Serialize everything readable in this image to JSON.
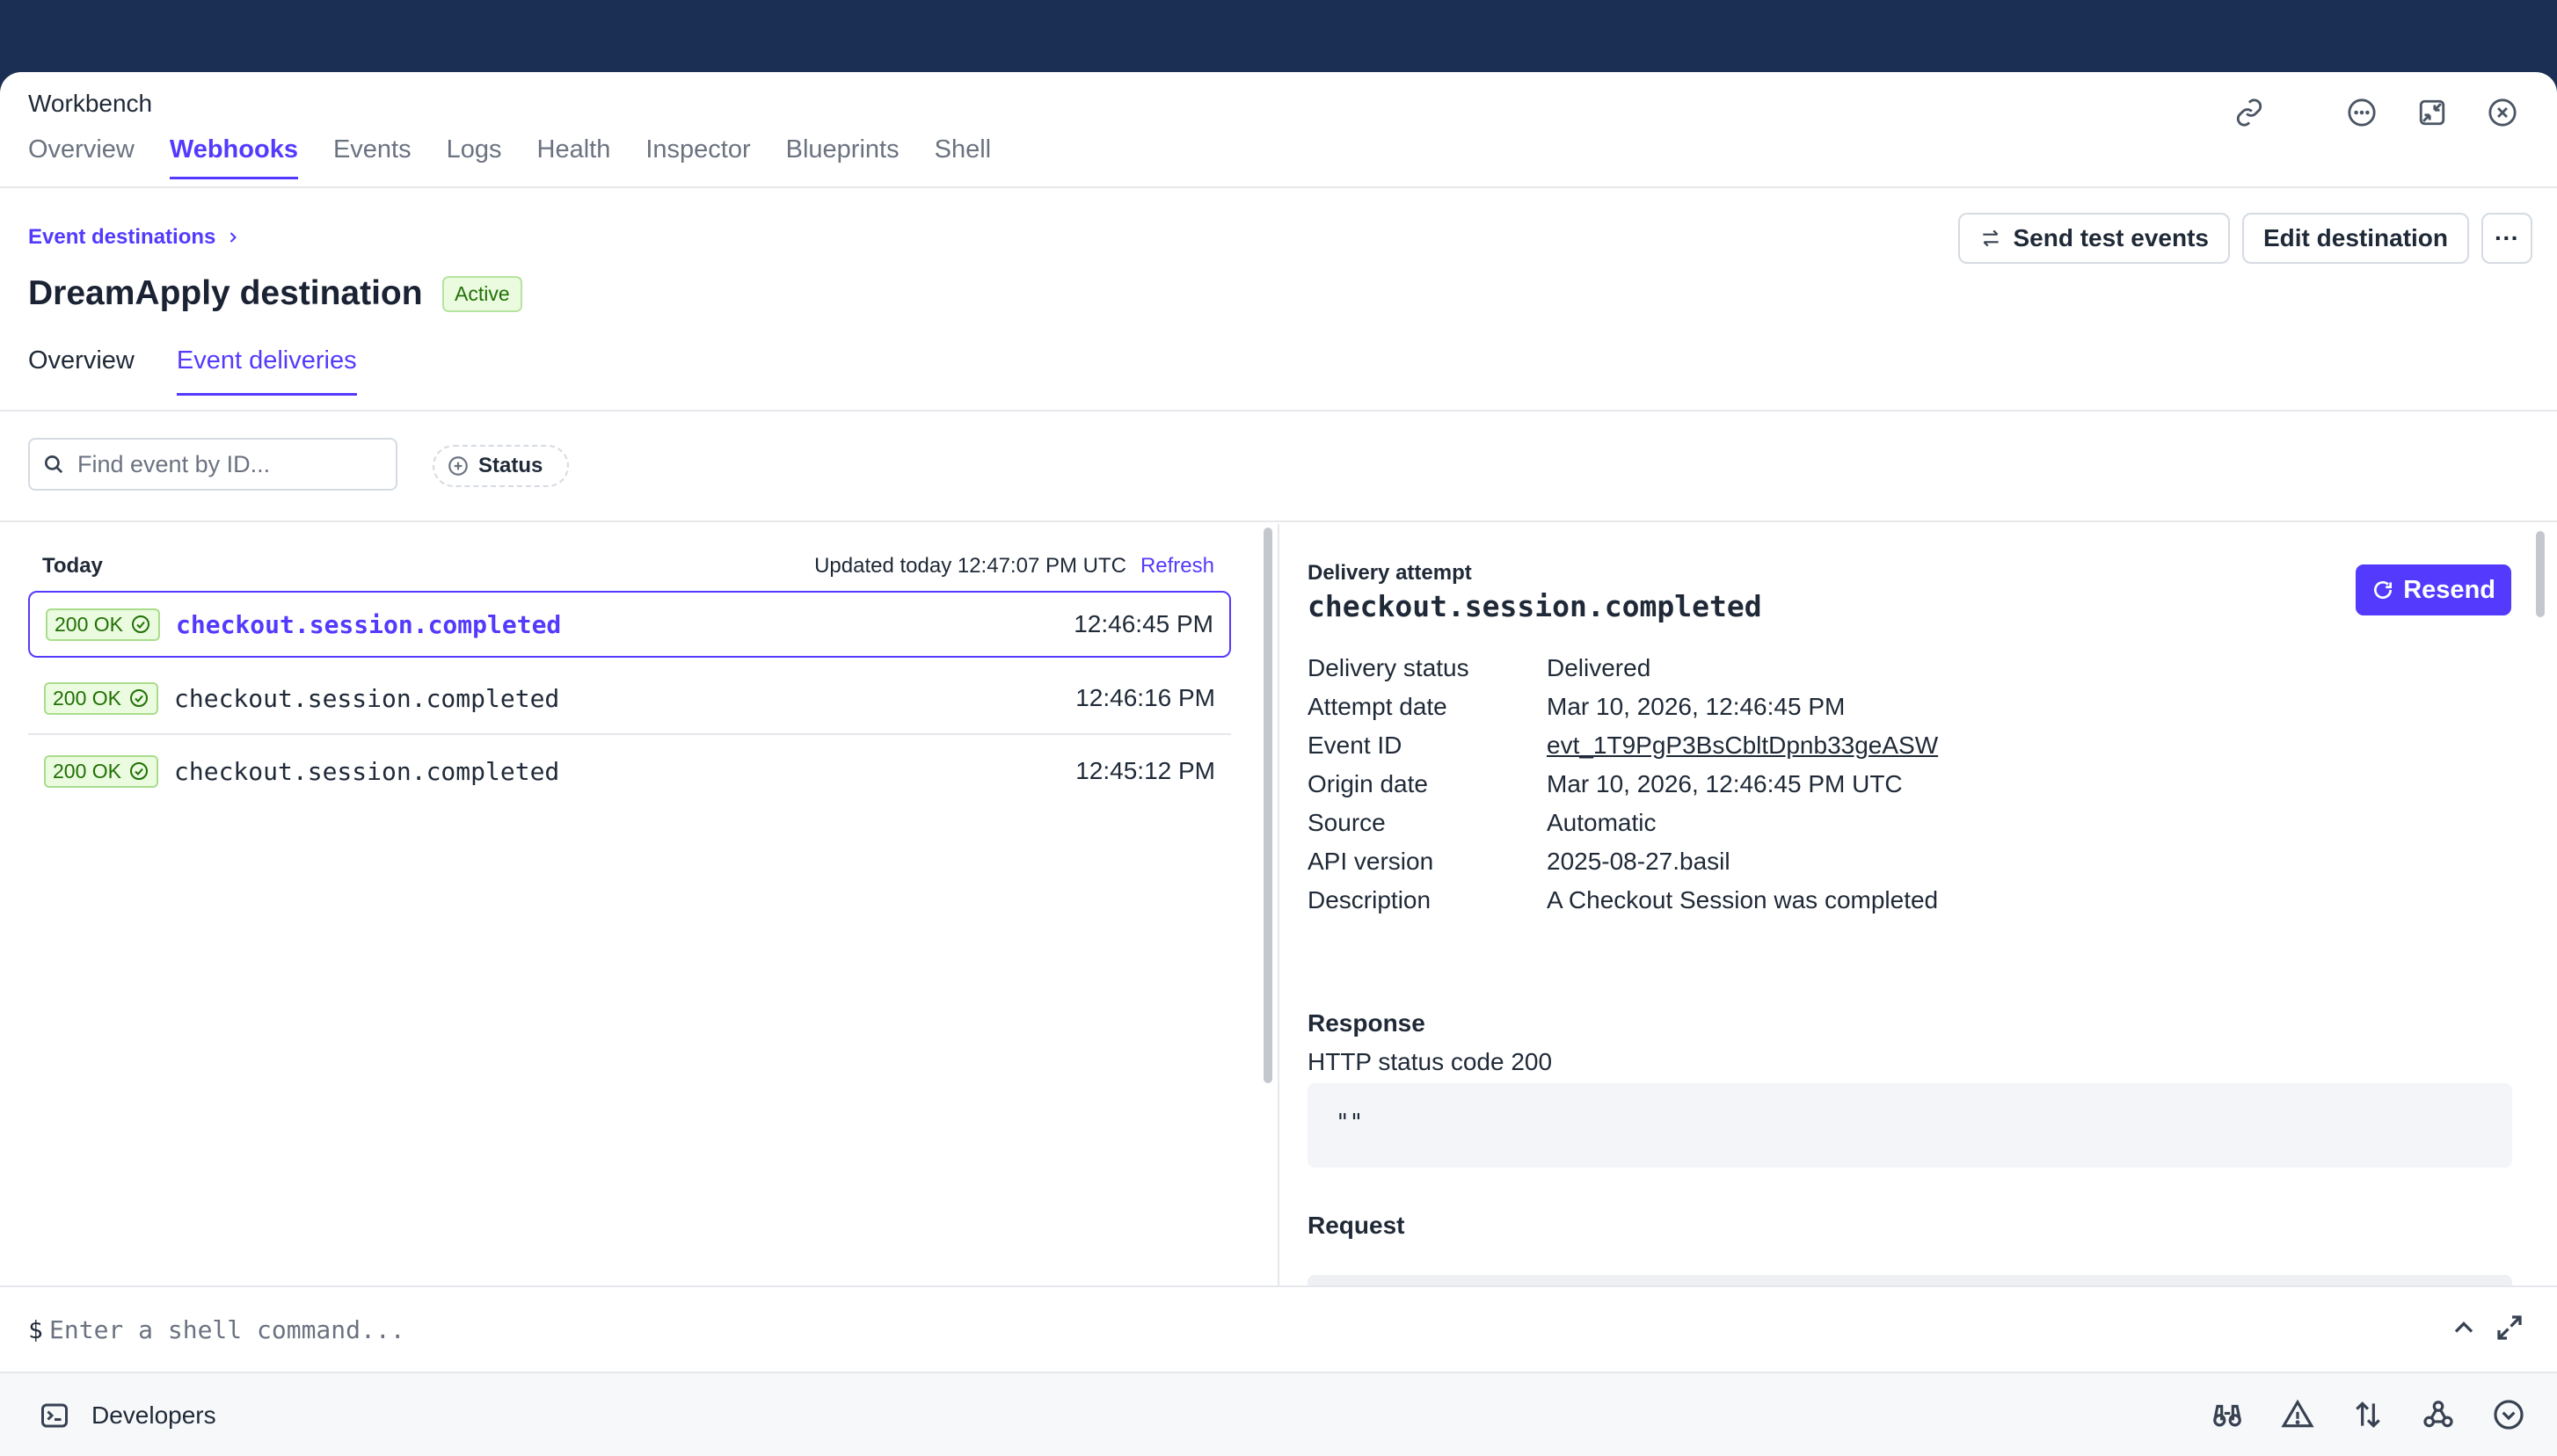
{
  "app": {
    "title": "Workbench",
    "tabs": [
      "Overview",
      "Webhooks",
      "Events",
      "Logs",
      "Health",
      "Inspector",
      "Blueprints",
      "Shell"
    ],
    "active_tab": "Webhooks",
    "window_icons": [
      "link-icon",
      "more-icon",
      "collapse-icon",
      "close-icon"
    ]
  },
  "header": {
    "breadcrumb": "Event destinations",
    "title": "DreamApply destination",
    "status_badge": "Active",
    "send_test_label": "Send test events",
    "edit_label": "Edit destination",
    "more_label": "···",
    "subtabs": [
      "Overview",
      "Event deliveries"
    ],
    "active_subtab": "Event deliveries"
  },
  "filters": {
    "search_placeholder": "Find event by ID...",
    "status_label": "Status"
  },
  "deliveries": {
    "group_label": "Today",
    "updated_text": "Updated today 12:47:07 PM UTC",
    "refresh_label": "Refresh",
    "rows": [
      {
        "status": "200 OK",
        "event": "checkout.session.completed",
        "time": "12:46:45 PM",
        "selected": true
      },
      {
        "status": "200 OK",
        "event": "checkout.session.completed",
        "time": "12:46:16 PM",
        "selected": false
      },
      {
        "status": "200 OK",
        "event": "checkout.session.completed",
        "time": "12:45:12 PM",
        "selected": false
      }
    ]
  },
  "detail": {
    "section_label": "Delivery attempt",
    "event_type": "checkout.session.completed",
    "resend_label": "Resend",
    "fields": [
      {
        "label": "Delivery status",
        "value": "Delivered"
      },
      {
        "label": "Attempt date",
        "value": "Mar 10, 2026, 12:46:45 PM"
      },
      {
        "label": "Event ID",
        "value": "evt_1T9PgP3BsCbltDpnb33geASW"
      },
      {
        "label": "Origin date",
        "value": "Mar 10, 2026, 12:46:45 PM UTC"
      },
      {
        "label": "Source",
        "value": "Automatic"
      },
      {
        "label": "API version",
        "value": "2025-08-27.basil"
      },
      {
        "label": "Description",
        "value": "A Checkout Session was completed"
      }
    ],
    "response_heading": "Response",
    "response_status": "HTTP status code 200",
    "response_body": "\"\"",
    "request_heading": "Request"
  },
  "shell": {
    "prompt": "$",
    "placeholder": "Enter a shell command..."
  },
  "devbar": {
    "label": "Developers",
    "tools": [
      "binoculars-icon",
      "warning-icon",
      "sort-arrows-icon",
      "webhook-icon",
      "chevron-down-circle-icon"
    ]
  },
  "colors": {
    "accent": "#533afd",
    "topbar_bg": "#1b2f55",
    "success": "#217005",
    "success_bg": "#eafbdf"
  }
}
